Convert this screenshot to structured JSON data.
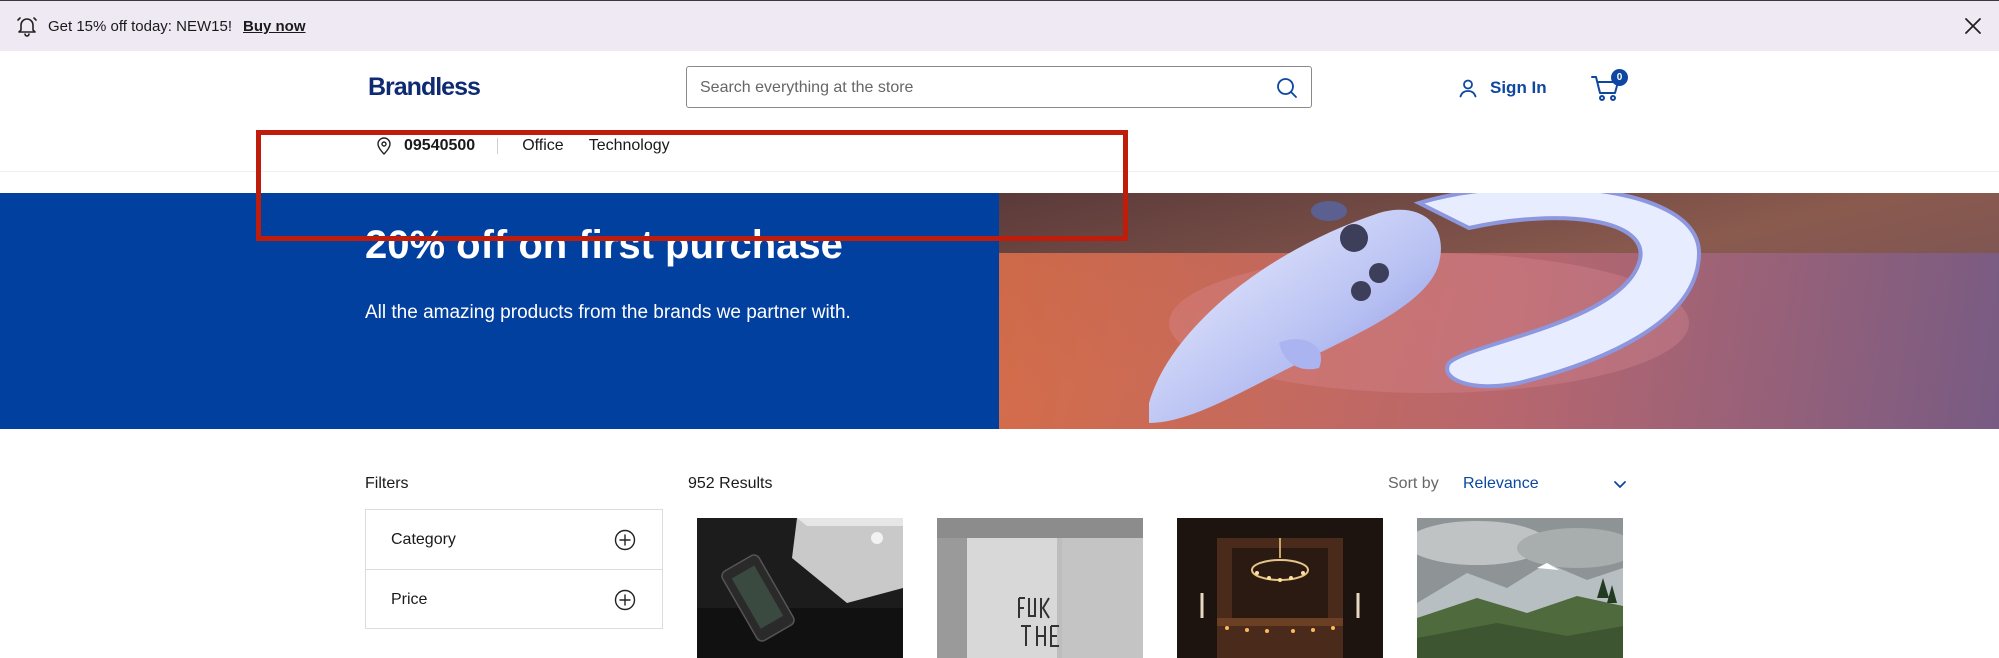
{
  "promo": {
    "text": "Get 15% off today: NEW15!",
    "link": "Buy now",
    "bell_icon": "bell-icon",
    "close_icon": "close-icon"
  },
  "header": {
    "logo": "Brandless",
    "search_placeholder": "Search everything at the store",
    "search_icon": "search-icon",
    "signin_label": "Sign In",
    "user_icon": "user-icon",
    "cart_icon": "cart-icon",
    "cart_count": "0"
  },
  "subnav": {
    "pin_icon": "location-pin-icon",
    "zip": "09540500",
    "links": [
      "Office",
      "Technology"
    ]
  },
  "hero": {
    "title": "20% off on first purchase",
    "subtitle": "All the amazing products from the brands we partner with."
  },
  "filters": {
    "title": "Filters",
    "items": [
      "Category",
      "Price"
    ]
  },
  "results": {
    "count_label": "952 Results",
    "sort_label": "Sort by",
    "sort_value": "Relevance"
  },
  "colors": {
    "accent": "#0d47a1",
    "hero_bg": "#0240a0",
    "promo_bg": "#efe9f4",
    "highlight": "#c01c0c"
  }
}
